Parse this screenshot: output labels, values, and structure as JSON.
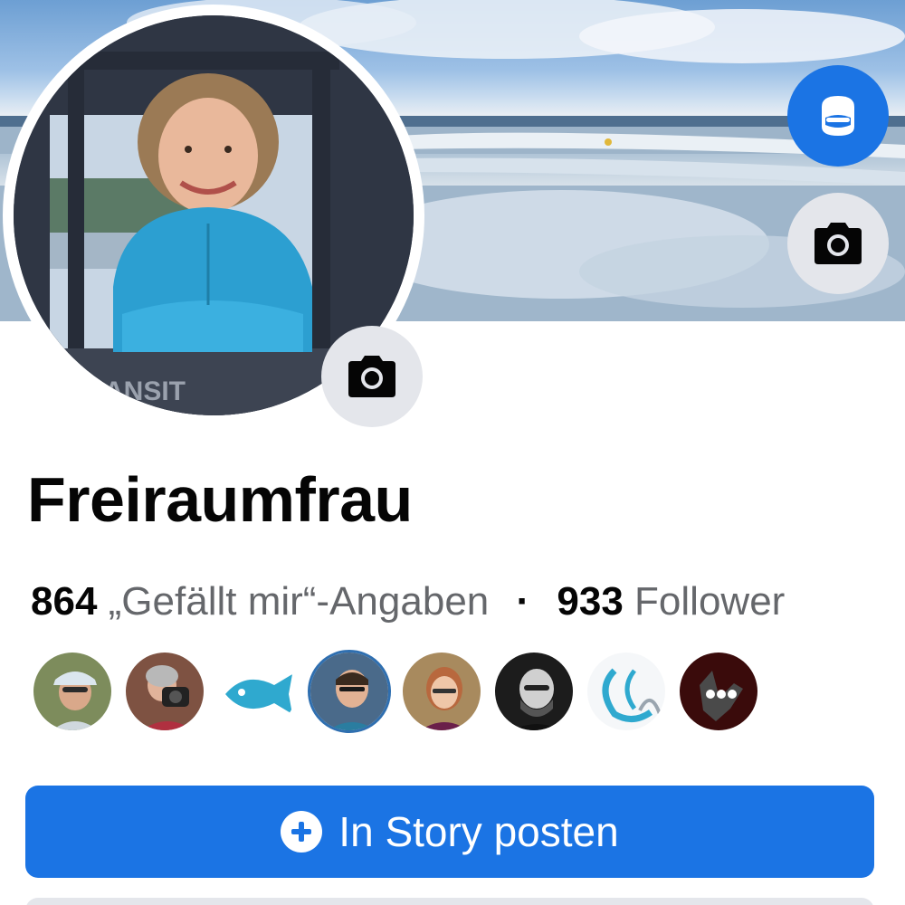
{
  "profile": {
    "name": "Freiraumfrau",
    "likes_count": "864",
    "likes_label": "„Gefällt mir“-Angaben",
    "separator": "·",
    "followers_count": "933",
    "followers_label": "Follower"
  },
  "cover": {
    "edit_icon": "camera-icon",
    "avatar_creator_icon": "avatar-creator-icon"
  },
  "avatar": {
    "edit_icon": "camera-icon",
    "van_text": "ANSIT"
  },
  "friends": [
    {
      "name": "friend-1",
      "color": "#8a9a6a"
    },
    {
      "name": "friend-2",
      "color": "#8a5a4a"
    },
    {
      "name": "friend-3",
      "color": "#2fa9cf"
    },
    {
      "name": "friend-4",
      "color": "#3b6f9e"
    },
    {
      "name": "friend-5",
      "color": "#b07a5a"
    },
    {
      "name": "friend-6",
      "color": "#2b2b2b"
    },
    {
      "name": "friend-7",
      "color": "#f3f6f8"
    },
    {
      "name": "more-friends",
      "icon": "more-icon",
      "color": "#3a0b0b"
    }
  ],
  "actions": {
    "story_label": "In Story posten",
    "story_icon": "plus-circle-icon"
  },
  "colors": {
    "accent": "#1b74e4",
    "secondary_button": "#e4e6eb",
    "text_primary": "#050505",
    "text_secondary": "#65676b"
  }
}
